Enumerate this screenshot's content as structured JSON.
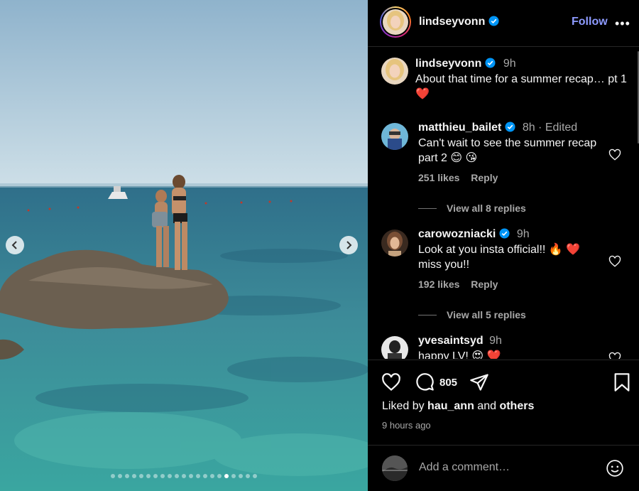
{
  "post": {
    "username": "lindseyvonn",
    "follow_label": "Follow",
    "more_label": "•••",
    "caption": {
      "username": "lindseyvonn",
      "time": "9h",
      "text": "About that time for a summer recap… pt 1",
      "emoji": "❤️"
    }
  },
  "comments": [
    {
      "username": "matthieu_bailet",
      "time": "8h · Edited",
      "text": "Can't wait to see the summer recap part 2",
      "emoji": "😊 😘",
      "likes": "251 likes",
      "reply_label": "Reply",
      "view_replies": "View all 8 replies"
    },
    {
      "username": "carowozniacki",
      "time": "9h",
      "text": "Look at you insta official!!",
      "emoji": "🔥 ❤️",
      "text2": "miss you!!",
      "likes": "192 likes",
      "reply_label": "Reply",
      "view_replies": "View all 5 replies"
    },
    {
      "username": "yvesaintsyd",
      "time": "9h",
      "text": "happy LV!",
      "emoji": "😍 ❤️"
    }
  ],
  "actions": {
    "comment_count": "805",
    "liked_prefix": "Liked by",
    "liked_user": "hau_ann",
    "liked_and": "and",
    "liked_others": "others",
    "time_ago": "9 hours ago"
  },
  "add_comment": {
    "placeholder": "Add a comment…"
  },
  "carousel": {
    "slide_count": 21,
    "active_index": 16
  },
  "colors": {
    "follow": "#8e9bff",
    "verified": "#0095f6",
    "background": "#000000"
  },
  "icons": {
    "like": "heart-icon",
    "comment": "speech-bubble-icon",
    "share": "paper-plane-icon",
    "save": "bookmark-icon",
    "emoji": "smiley-icon",
    "verified": "verified-badge-icon"
  }
}
